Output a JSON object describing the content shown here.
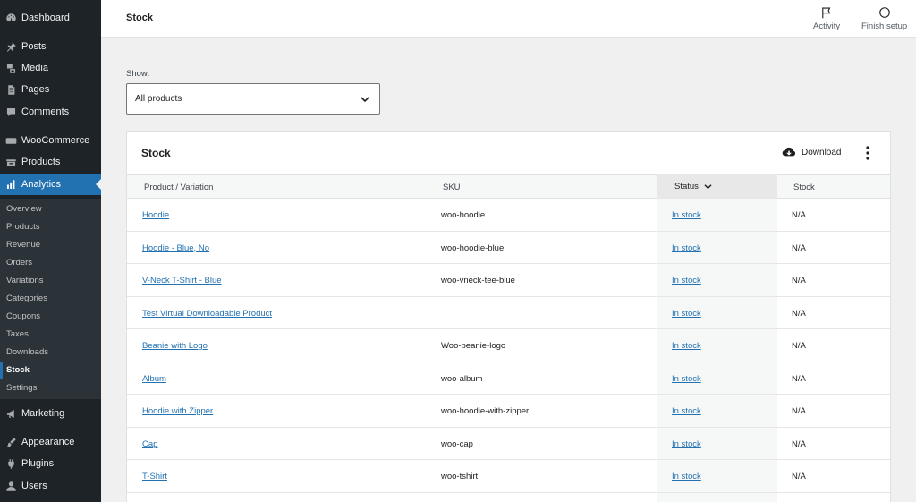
{
  "sidebar": {
    "menu": [
      {
        "label": "Dashboard",
        "icon": "dashboard-icon"
      },
      {
        "label": "Posts",
        "icon": "pin-icon"
      },
      {
        "label": "Media",
        "icon": "media-icon"
      },
      {
        "label": "Pages",
        "icon": "pages-icon"
      },
      {
        "label": "Comments",
        "icon": "comment-icon"
      },
      {
        "label": "WooCommerce",
        "icon": "woocommerce-icon"
      },
      {
        "label": "Products",
        "icon": "products-icon"
      },
      {
        "label": "Analytics",
        "icon": "bar-chart-icon"
      },
      {
        "label": "Marketing",
        "icon": "megaphone-icon"
      },
      {
        "label": "Appearance",
        "icon": "brush-icon"
      },
      {
        "label": "Plugins",
        "icon": "plug-icon"
      },
      {
        "label": "Users",
        "icon": "user-icon"
      }
    ],
    "submenu": [
      "Overview",
      "Products",
      "Revenue",
      "Orders",
      "Variations",
      "Categories",
      "Coupons",
      "Taxes",
      "Downloads",
      "Stock",
      "Settings"
    ],
    "active_submenu": "Stock"
  },
  "header": {
    "title": "Stock",
    "activity_label": "Activity",
    "finish_setup_label": "Finish setup"
  },
  "filter": {
    "show_label": "Show:",
    "selected": "All products"
  },
  "card": {
    "title": "Stock",
    "download_label": "Download",
    "columns": [
      "Product / Variation",
      "SKU",
      "Status",
      "Stock"
    ],
    "rows": [
      {
        "product": "Hoodie",
        "sku": "woo-hoodie",
        "status": "In stock",
        "stock": "N/A"
      },
      {
        "product": "Hoodie - Blue, No",
        "sku": "woo-hoodie-blue",
        "status": "In stock",
        "stock": "N/A"
      },
      {
        "product": "V-Neck T-Shirt - Blue",
        "sku": "woo-vneck-tee-blue",
        "status": "In stock",
        "stock": "N/A"
      },
      {
        "product": "Test Virtual Downloadable Product",
        "sku": "",
        "status": "In stock",
        "stock": "N/A"
      },
      {
        "product": "Beanie with Logo",
        "sku": "Woo-beanie-logo",
        "status": "In stock",
        "stock": "N/A"
      },
      {
        "product": "Album",
        "sku": "woo-album",
        "status": "In stock",
        "stock": "N/A"
      },
      {
        "product": "Hoodie with Zipper",
        "sku": "woo-hoodie-with-zipper",
        "status": "In stock",
        "stock": "N/A"
      },
      {
        "product": "Cap",
        "sku": "woo-cap",
        "status": "In stock",
        "stock": "N/A"
      },
      {
        "product": "T-Shirt",
        "sku": "woo-tshirt",
        "status": "In stock",
        "stock": "N/A"
      }
    ]
  },
  "colors": {
    "sidebar_bg": "#1d2327",
    "accent": "#2271b1",
    "link": "#2271b1"
  }
}
